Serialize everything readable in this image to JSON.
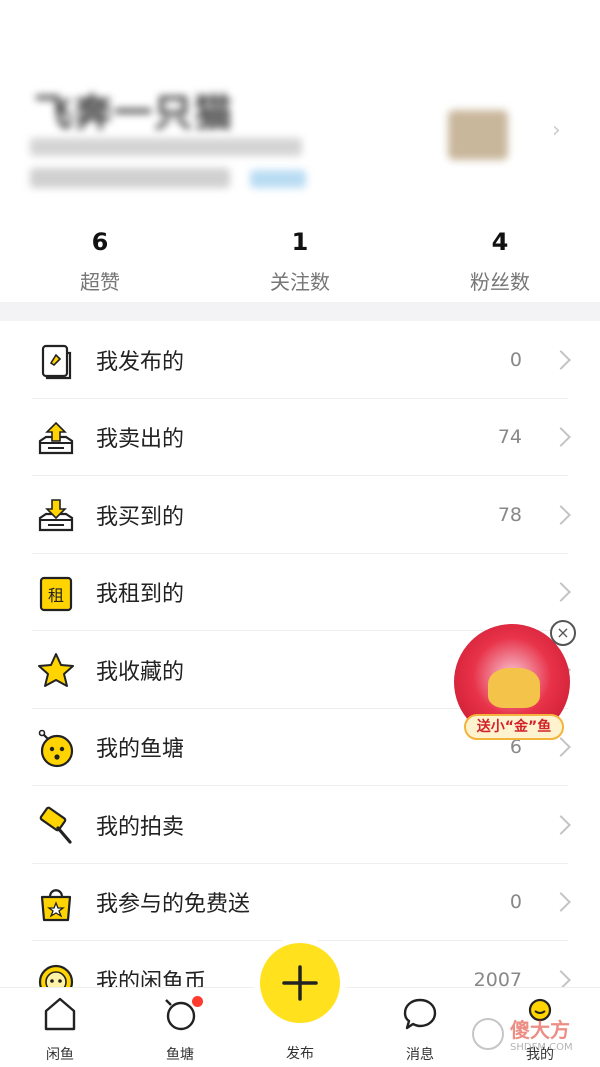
{
  "profile": {
    "name": "飞奔一只猫"
  },
  "stats": [
    {
      "value": "6",
      "label": "超赞"
    },
    {
      "value": "1",
      "label": "关注数"
    },
    {
      "value": "4",
      "label": "粉丝数"
    }
  ],
  "menu": [
    {
      "label": "我发布的",
      "count": "0",
      "icon": "document-icon"
    },
    {
      "label": "我卖出的",
      "count": "74",
      "icon": "upload-box-icon"
    },
    {
      "label": "我买到的",
      "count": "78",
      "icon": "download-box-icon"
    },
    {
      "label": "我租到的",
      "count": "",
      "icon": "rent-icon"
    },
    {
      "label": "我收藏的",
      "count": "",
      "icon": "star-icon"
    },
    {
      "label": "我的鱼塘",
      "count": "6",
      "icon": "pond-icon"
    },
    {
      "label": "我的拍卖",
      "count": "",
      "icon": "auction-hammer-icon"
    },
    {
      "label": "我参与的免费送",
      "count": "0",
      "icon": "gift-bag-icon"
    },
    {
      "label": "我的闲鱼币",
      "count": "2007",
      "icon": "coin-icon"
    }
  ],
  "menu_misc": {
    "rent_glyph": "租"
  },
  "float_ad": {
    "text": "送小“金”鱼",
    "close": "×"
  },
  "tabbar": {
    "items": [
      {
        "label": "闲鱼",
        "icon": "home-icon"
      },
      {
        "label": "鱼塘",
        "icon": "pond-tab-icon"
      },
      {
        "label": "发布",
        "icon": "plus-icon"
      },
      {
        "label": "消息",
        "icon": "chat-icon"
      },
      {
        "label": "我的",
        "icon": "profile-face-icon"
      }
    ]
  },
  "watermark": {
    "text": "傻大方",
    "sub": "SHDFM.COM"
  },
  "colors": {
    "accent": "#ffe11e",
    "icon_yellow": "#ffd400",
    "badge": "#ff3b30",
    "ad_red": "#d2232a"
  }
}
